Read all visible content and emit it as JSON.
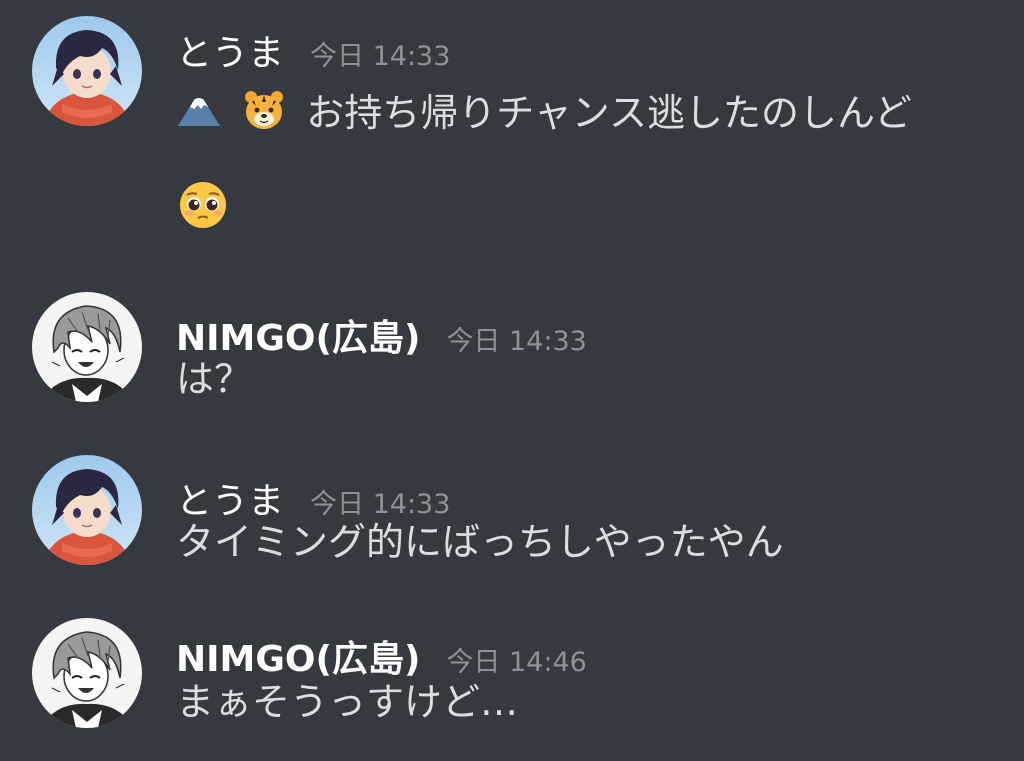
{
  "messages": [
    {
      "author": "とうま",
      "timestamp": "今日 14:33",
      "text": "お持ち帰りチャンス逃したのしんど",
      "leading_emoji": [
        "mount-fuji",
        "tiger-face"
      ],
      "extra_emoji": "pleading-face",
      "avatar_style": "anime-red-scarf"
    },
    {
      "author": "NIMGO(広島)",
      "timestamp": "今日 14:33",
      "text": "は？",
      "avatar_style": "manga-monochrome"
    },
    {
      "author": "とうま",
      "timestamp": "今日 14:33",
      "text": "タイミング的にばっちしやったやん",
      "avatar_style": "anime-red-scarf"
    },
    {
      "author": "NIMGO(広島)",
      "timestamp": "今日 14:46",
      "text": "まぁそうっすけど…",
      "avatar_style": "manga-monochrome"
    }
  ],
  "colors": {
    "background": "#36393f",
    "username": "#ffffff",
    "timestamp": "#8e9297",
    "text": "#dcddde"
  }
}
